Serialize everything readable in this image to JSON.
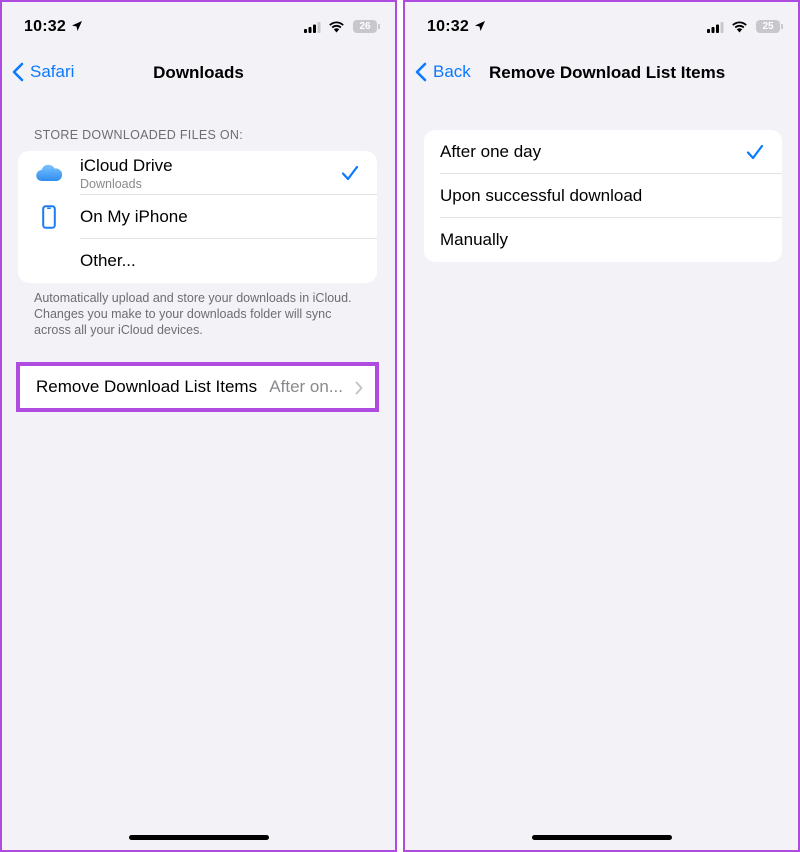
{
  "left": {
    "status": {
      "time": "10:32",
      "battery": "26"
    },
    "nav": {
      "back_label": "Safari",
      "title": "Downloads"
    },
    "section_header": "STORE DOWNLOADED FILES ON:",
    "options": [
      {
        "label": "iCloud Drive",
        "sublabel": "Downloads",
        "icon": "icloud-icon",
        "selected": true
      },
      {
        "label": "On My iPhone",
        "icon": "iphone-icon",
        "selected": false
      },
      {
        "label": "Other...",
        "selected": false
      }
    ],
    "footer_note": "Automatically upload and store your downloads in iCloud. Changes you make to your downloads folder will sync across all your iCloud devices.",
    "remove_row": {
      "label": "Remove Download List Items",
      "value": "After on..."
    }
  },
  "right": {
    "status": {
      "time": "10:32",
      "battery": "25"
    },
    "nav": {
      "back_label": "Back",
      "title": "Remove Download List Items"
    },
    "options": [
      {
        "label": "After one day",
        "selected": true
      },
      {
        "label": "Upon successful download",
        "selected": false
      },
      {
        "label": "Manually",
        "selected": false
      }
    ]
  },
  "colors": {
    "accent": "#0a7aff",
    "highlight": "#b04be0",
    "background": "#f2f2f7"
  }
}
